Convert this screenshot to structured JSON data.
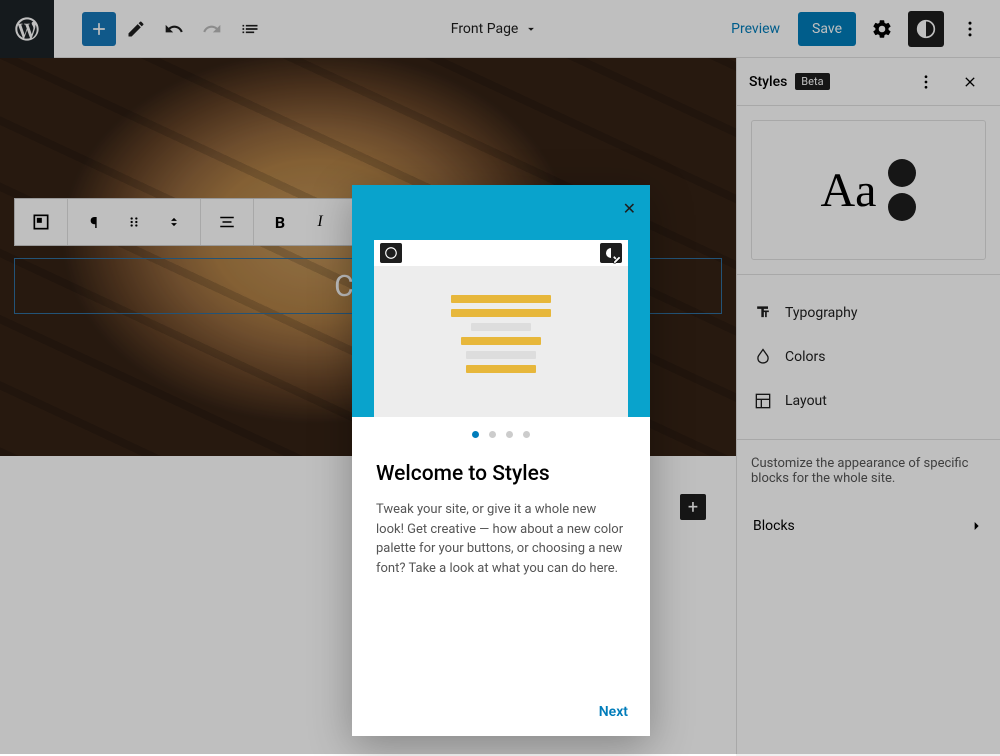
{
  "toolbar": {
    "page_title": "Front Page",
    "preview": "Preview",
    "save": "Save"
  },
  "canvas": {
    "title_text": "CAF"
  },
  "sidebar": {
    "title": "Styles",
    "badge": "Beta",
    "preview_text": "Aa",
    "items": [
      {
        "label": "Typography"
      },
      {
        "label": "Colors"
      },
      {
        "label": "Layout"
      }
    ],
    "desc": "Customize the appearance of specific blocks for the whole site.",
    "blocks_label": "Blocks"
  },
  "modal": {
    "title": "Welcome to Styles",
    "body": "Tweak your site, or give it a whole new look! Get creative — how about a new color palette for your buttons, or choosing a new font? Take a look at what you can do here.",
    "next": "Next"
  }
}
